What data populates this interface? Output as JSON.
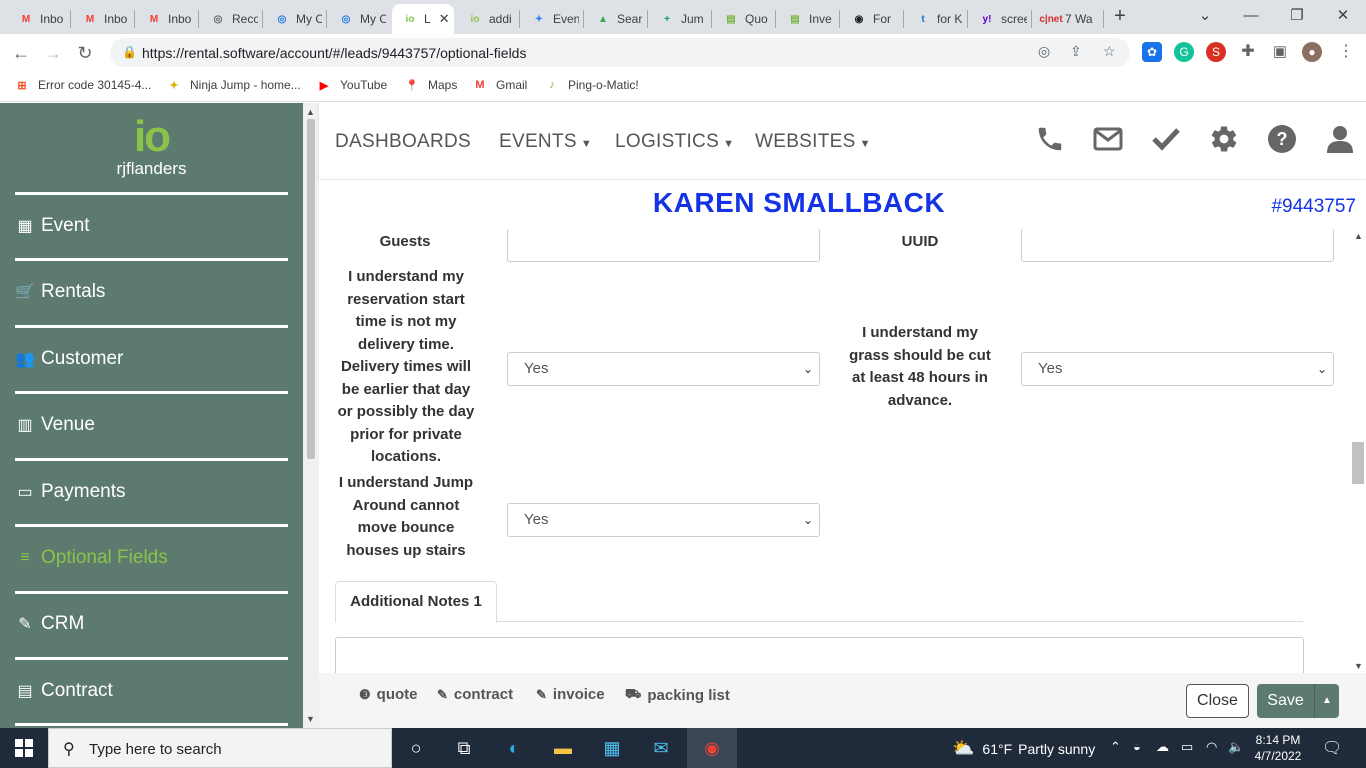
{
  "browser": {
    "tabs": [
      {
        "title": "Inbo",
        "fav": "M",
        "color": "#ea4335"
      },
      {
        "title": "Inbo",
        "fav": "M",
        "color": "#ea4335"
      },
      {
        "title": "Inbo",
        "fav": "M",
        "color": "#ea4335"
      },
      {
        "title": "Reco",
        "fav": "◎",
        "color": "#5f6368"
      },
      {
        "title": "My C",
        "fav": "◎",
        "color": "#1a73e8"
      },
      {
        "title": "My C",
        "fav": "◎",
        "color": "#1a73e8"
      },
      {
        "title": "L",
        "fav": "io",
        "color": "#8bc34a"
      },
      {
        "title": "addi",
        "fav": "io",
        "color": "#8bc34a"
      },
      {
        "title": "Even",
        "fav": "✦",
        "color": "#4285f4"
      },
      {
        "title": "Sear",
        "fav": "▲",
        "color": "#34a853"
      },
      {
        "title": "Jum",
        "fav": "+",
        "color": "#0f9d58"
      },
      {
        "title": "Quo",
        "fav": "▤",
        "color": "#7cb342"
      },
      {
        "title": "Inve",
        "fav": "▤",
        "color": "#7cb342"
      },
      {
        "title": "For",
        "fav": "◉",
        "color": "#222222"
      },
      {
        "title": "for K",
        "fav": "t",
        "color": "#1976d2"
      },
      {
        "title": "scree",
        "fav": "y!",
        "color": "#6001d2"
      },
      {
        "title": "7 Wa",
        "fav": "c|net",
        "color": "#d32f2f"
      }
    ],
    "url": "https://rental.software/account/#/leads/9443757/optional-fields",
    "bookmarks": [
      {
        "label": "Error code 30145-4...",
        "icon": "⊞",
        "color": "#f25022"
      },
      {
        "label": "Ninja Jump - home...",
        "icon": "✦",
        "color": "#e0b000"
      },
      {
        "label": "YouTube",
        "icon": "▶",
        "color": "#ff0000"
      },
      {
        "label": "Maps",
        "icon": "📍",
        "color": "#34a853"
      },
      {
        "label": "Gmail",
        "icon": "M",
        "color": "#ea4335"
      },
      {
        "label": "Ping-o-Matic!",
        "icon": "♪",
        "color": "#7cb342"
      }
    ]
  },
  "sidebar": {
    "logo_text": "io",
    "username": "rjflanders",
    "items": [
      {
        "label": "Event",
        "icon": "▦"
      },
      {
        "label": "Rentals",
        "icon": "🛒"
      },
      {
        "label": "Customer",
        "icon": "👥"
      },
      {
        "label": "Venue",
        "icon": "▥"
      },
      {
        "label": "Payments",
        "icon": "▭"
      },
      {
        "label": "Optional Fields",
        "icon": "≡"
      },
      {
        "label": "CRM",
        "icon": "✎"
      },
      {
        "label": "Contract",
        "icon": "▤"
      }
    ],
    "active_item": "Optional Fields"
  },
  "topnav": {
    "links": [
      {
        "label": "DASHBOARDS",
        "caret": false
      },
      {
        "label": "EVENTS",
        "caret": true
      },
      {
        "label": "LOGISTICS",
        "caret": true
      },
      {
        "label": "WEBSITES",
        "caret": true
      }
    ],
    "icons": [
      "phone-icon",
      "mail-icon",
      "check-icon",
      "gear-icon",
      "help-icon",
      "user-icon"
    ]
  },
  "lead": {
    "name": "KAREN SMALLBACK",
    "number": "#9443757"
  },
  "fields": {
    "guests_label": "Guests",
    "guests_value": "",
    "uuid_label": "UUID",
    "uuid_value": "",
    "reservation_label": "I understand my reservation start time is not my delivery time. Delivery times will be earlier that day or possibly the day prior for private locations.",
    "reservation_value": "Yes",
    "grass_label": "I understand my grass should be cut at least 48 hours in advance.",
    "grass_value": "Yes",
    "stairs_label": "I understand Jump Around cannot move bounce houses up stairs",
    "stairs_value": "Yes"
  },
  "notes": {
    "tab_label": "Additional Notes 1",
    "value": ""
  },
  "footer": {
    "links": [
      "quote",
      "contract",
      "invoice",
      "packing list"
    ],
    "close_label": "Close",
    "save_label": "Save"
  },
  "taskbar": {
    "search_placeholder": "Type here to search",
    "weather_temp": "61°F",
    "weather_text": "Partly sunny",
    "time": "8:14 PM",
    "date": "4/7/2022"
  },
  "colors": {
    "sidebar_bg": "#5d7a6f",
    "accent_green": "#8bc34a",
    "lead_blue": "#1433e6"
  }
}
